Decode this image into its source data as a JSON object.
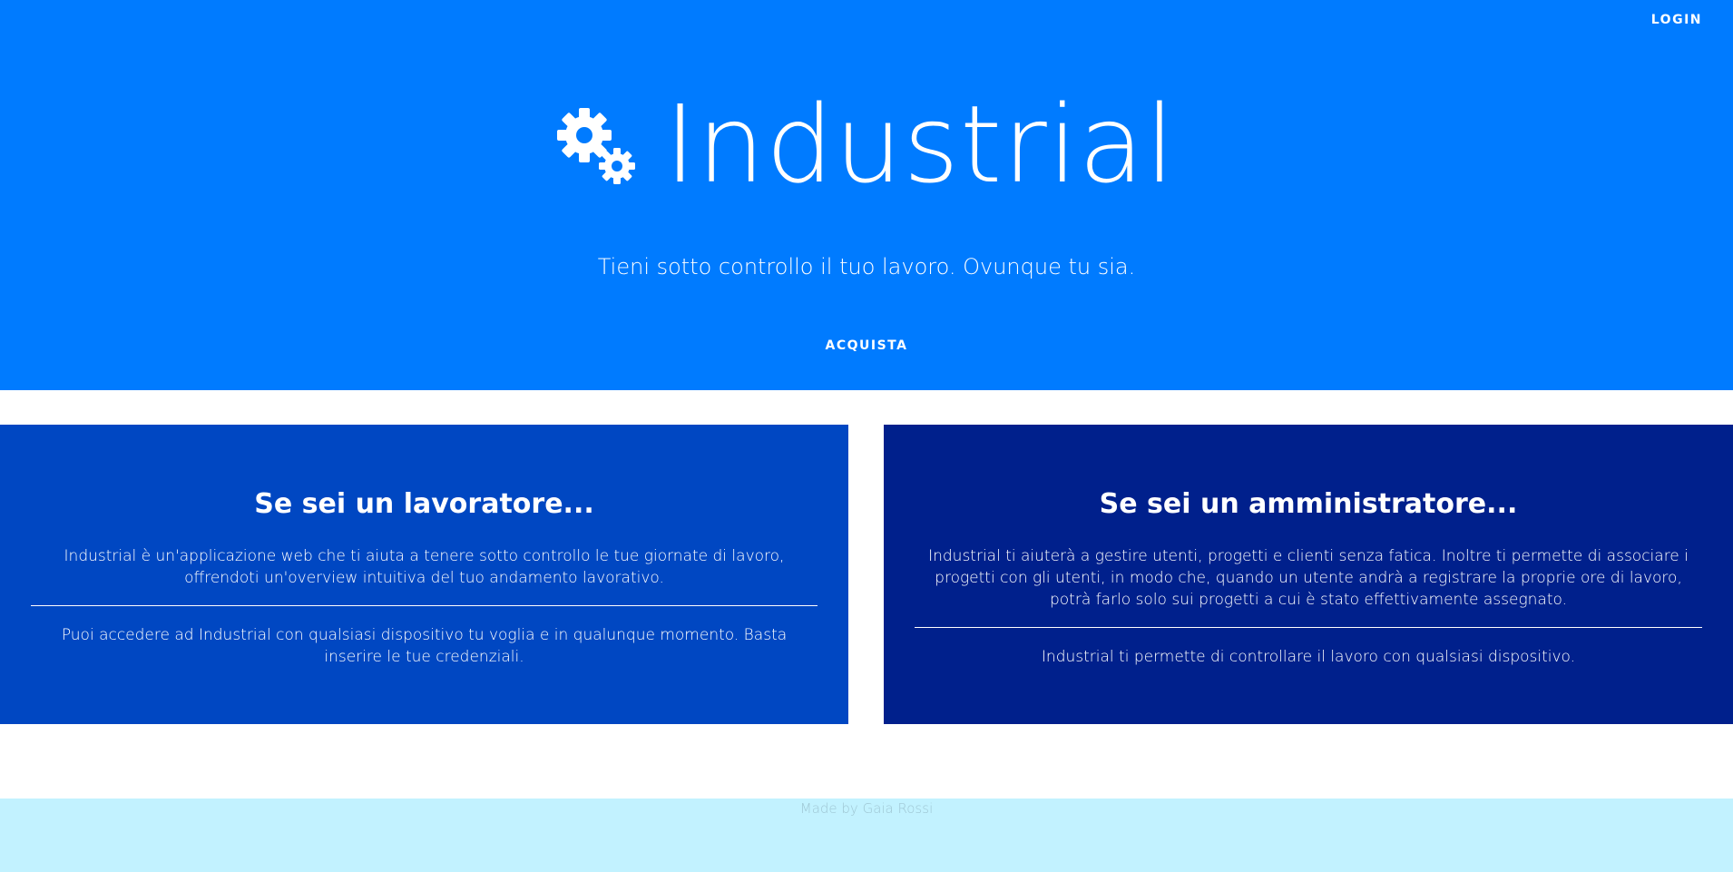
{
  "nav": {
    "login_label": "LOGIN"
  },
  "hero": {
    "icon": "gears-icon",
    "title": "Industrial",
    "tagline": "Tieni sotto controllo il tuo lavoro. Ovunque tu sia.",
    "buy_label": "ACQUISTA"
  },
  "cards": [
    {
      "title": "Se sei un lavoratore...",
      "paragraph1": "Industrial è un'applicazione web che ti aiuta a tenere sotto controllo le tue giornate di lavoro, offrendoti un'overview intuitiva del tuo andamento lavorativo.",
      "paragraph2": "Puoi accedere ad Industrial con qualsiasi dispositivo tu voglia e in qualunque momento. Basta inserire le tue credenziali."
    },
    {
      "title": "Se sei un amministratore...",
      "paragraph1": "Industrial ti aiuterà a gestire utenti, progetti e clienti senza fatica. Inoltre ti permette di associare i progetti con gli utenti, in modo che, quando un utente andrà a registrare la proprie ore di lavoro, potrà farlo solo sui progetti a cui è stato effettivamente assegnato.",
      "paragraph2": "Industrial ti permette di controllare il lavoro con qualsiasi dispositivo."
    }
  ],
  "footer": {
    "credit": "Made by Gaia Rossi"
  },
  "colors": {
    "hero_bg": "#007bff",
    "card_worker_bg": "#0047c2",
    "card_admin_bg": "#00208c",
    "footer_bg": "#c2f2ff"
  }
}
